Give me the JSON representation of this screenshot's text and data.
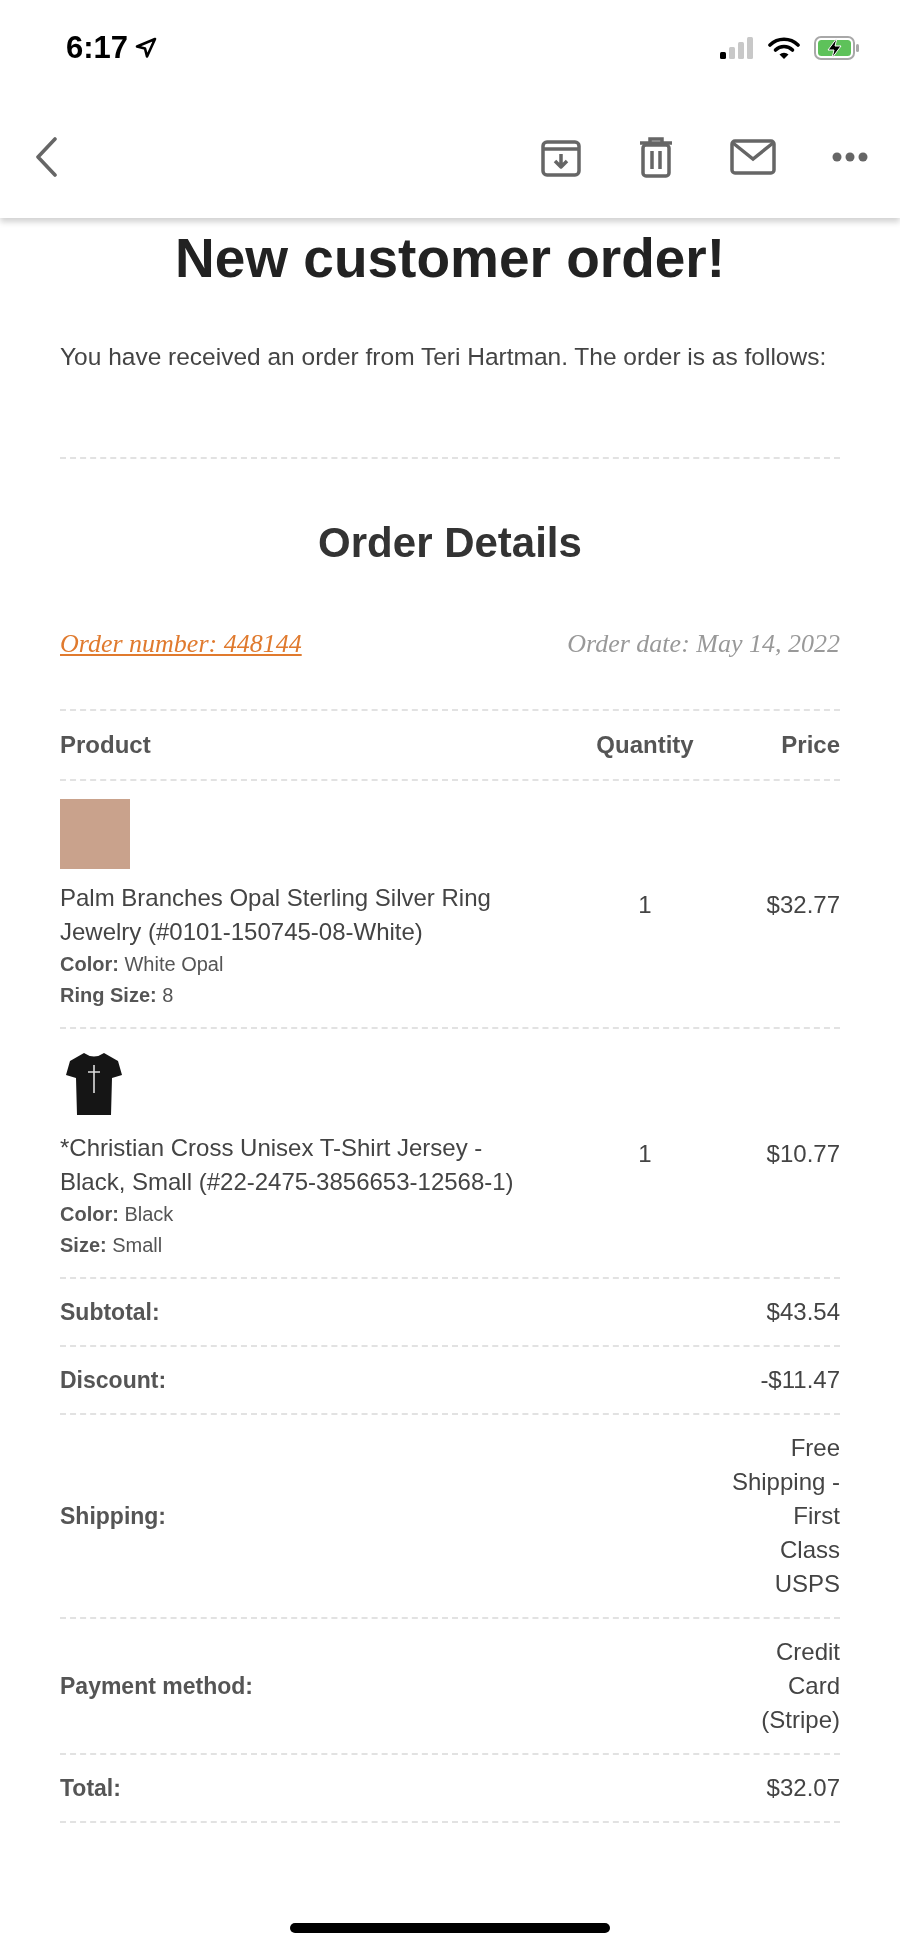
{
  "status_bar": {
    "time": "6:17"
  },
  "email": {
    "title": "New customer order!",
    "intro": "You have received an order from Teri Hartman. The order is as follows:",
    "section_title": "Order Details",
    "order_number": "Order number: 448144",
    "order_date": "Order date: May 14, 2022"
  },
  "table": {
    "columns": [
      "Product",
      "Quantity",
      "Price"
    ],
    "rows": [
      {
        "kind": "photo",
        "name": "Palm Branches Opal Sterling Silver Ring Jewelry (#0101-150745-08-White)",
        "meta": [
          {
            "label": "Color:",
            "value": "White Opal"
          },
          {
            "label": "Ring Size:",
            "value": "8"
          }
        ],
        "quantity": "1",
        "price": "$32.77"
      },
      {
        "kind": "tshirt",
        "name": "*Christian Cross Unisex T-Shirt Jersey - Black, Small (#22-2475-3856653-12568-1)",
        "meta": [
          {
            "label": "Color:",
            "value": "Black"
          },
          {
            "label": "Size:",
            "value": "Small"
          }
        ],
        "quantity": "1",
        "price": "$10.77"
      }
    ]
  },
  "totals": [
    {
      "label": "Subtotal:",
      "value": "$43.54"
    },
    {
      "label": "Discount:",
      "value": "-$11.47"
    },
    {
      "label": "Shipping:",
      "value": "Free Shipping - First Class USPS"
    },
    {
      "label": "Payment method:",
      "value": "Credit Card (Stripe)"
    },
    {
      "label": "Total:",
      "value": "$32.07"
    }
  ]
}
